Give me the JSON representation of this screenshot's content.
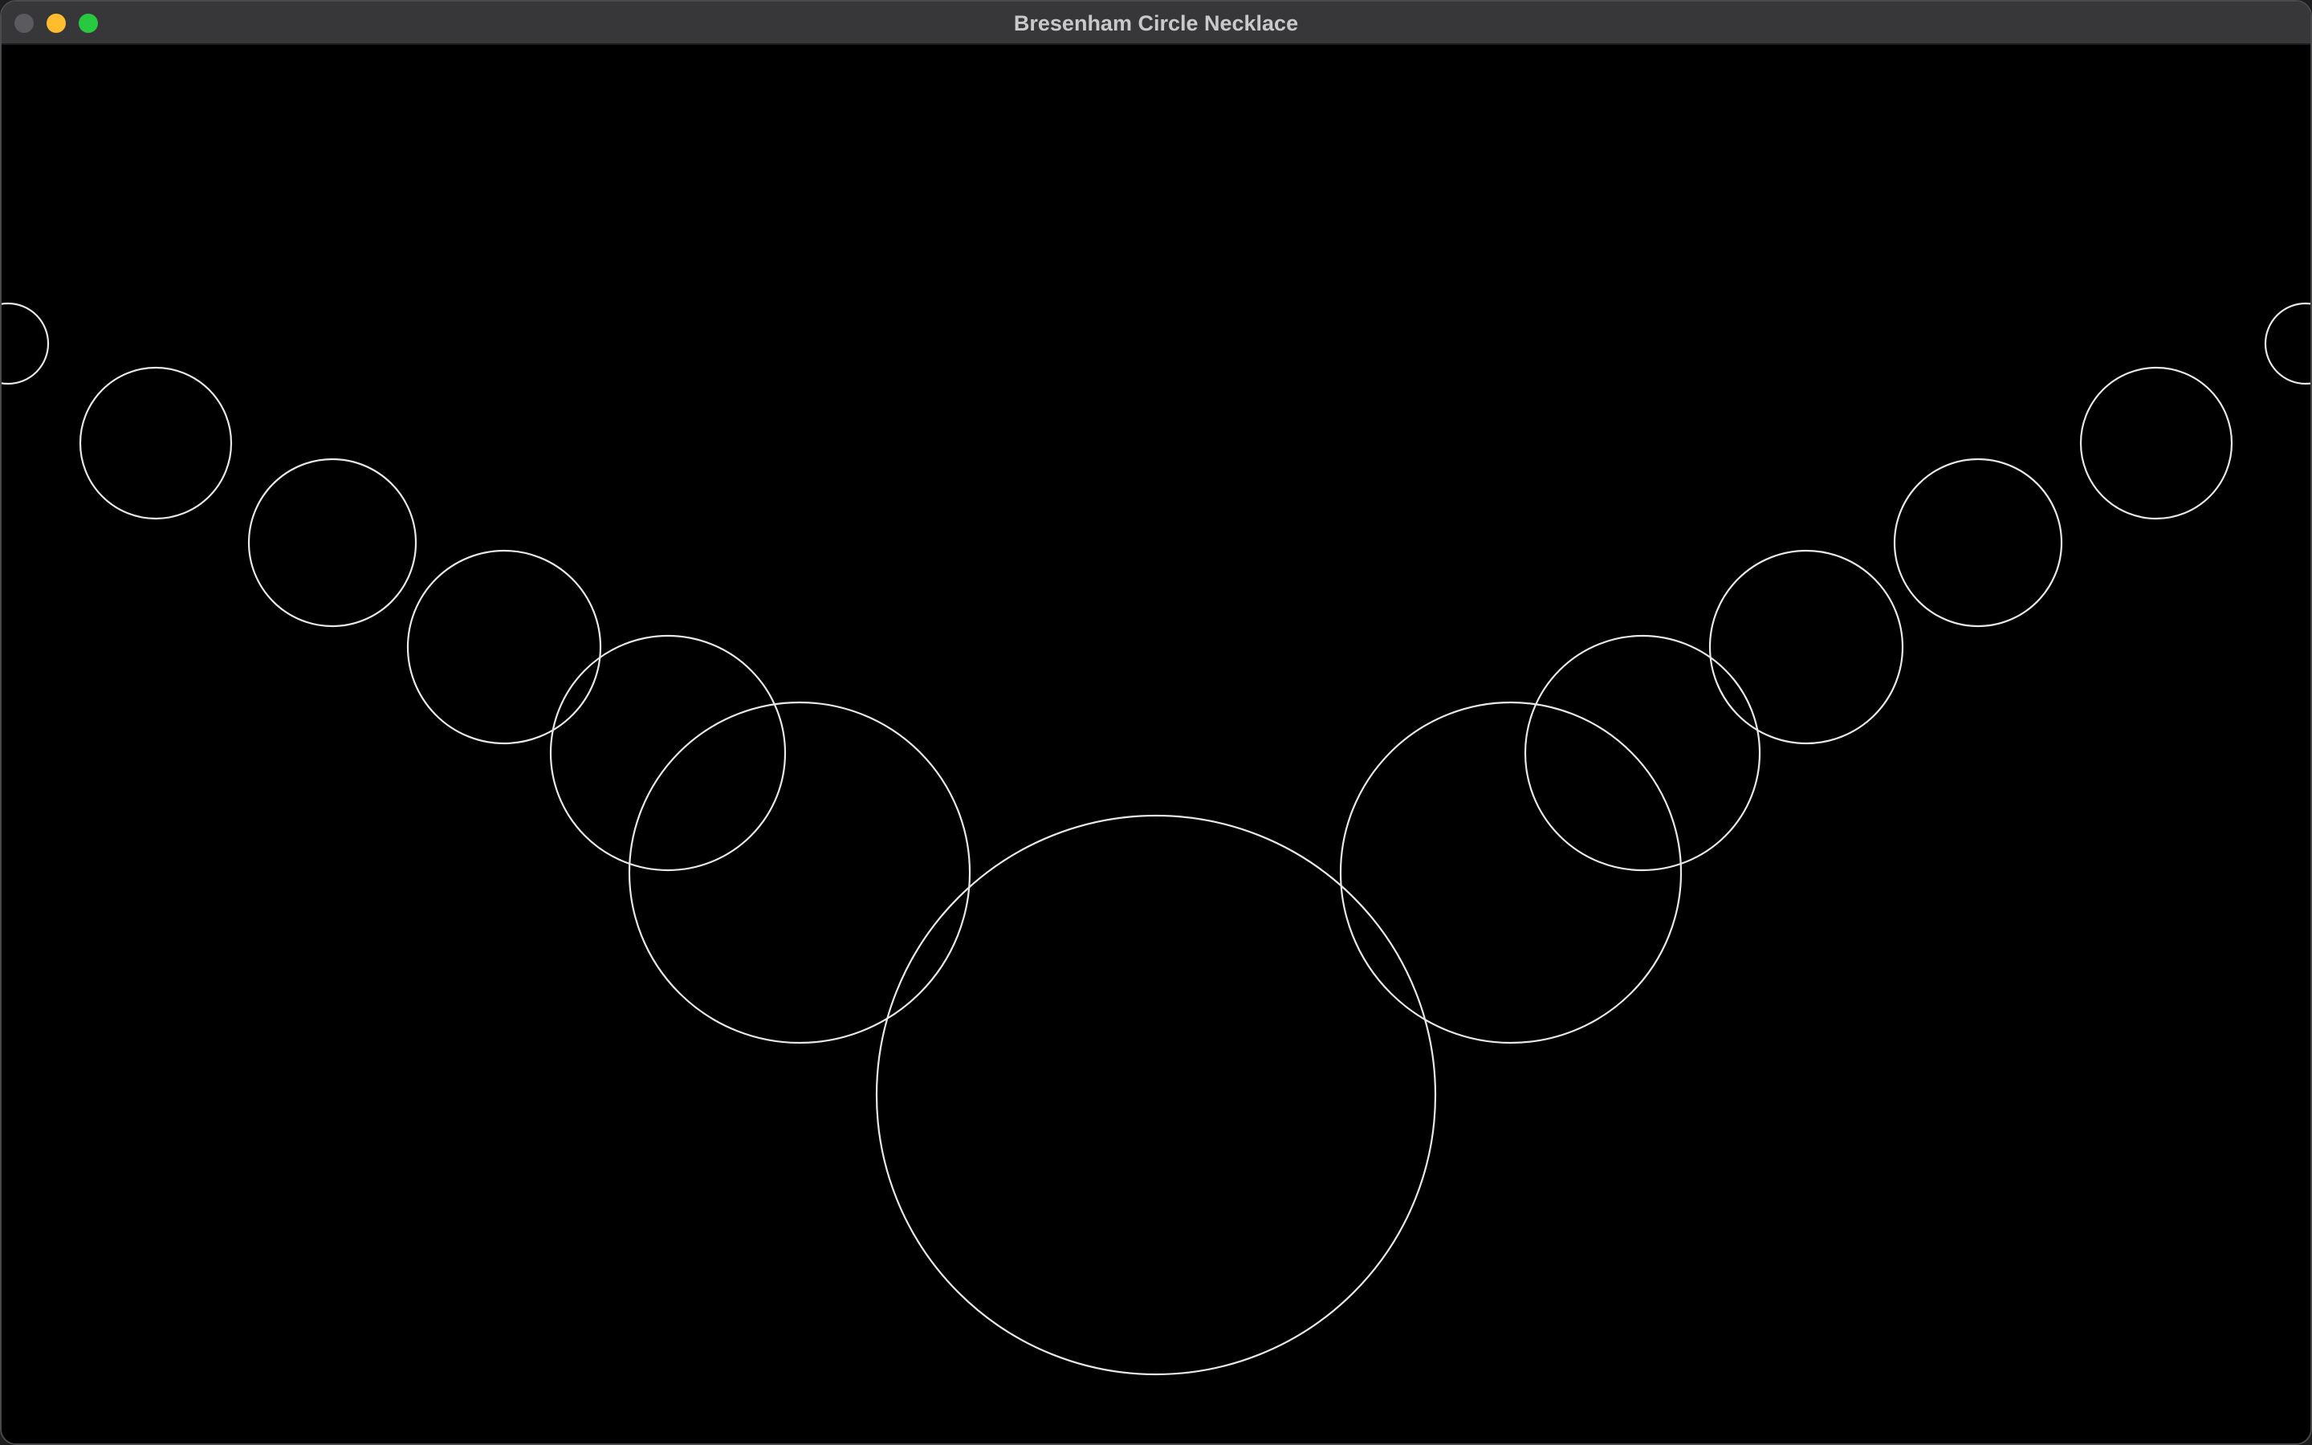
{
  "window": {
    "title": "Bresenham Circle Necklace"
  },
  "traffic_lights": {
    "close_color": "#5b5b5f",
    "minimize_color": "#febc2e",
    "maximize_color": "#28c840"
  },
  "canvas": {
    "background_color": "#000000",
    "stroke_color": "#e8e8e8",
    "shape": "circle-outline"
  }
}
